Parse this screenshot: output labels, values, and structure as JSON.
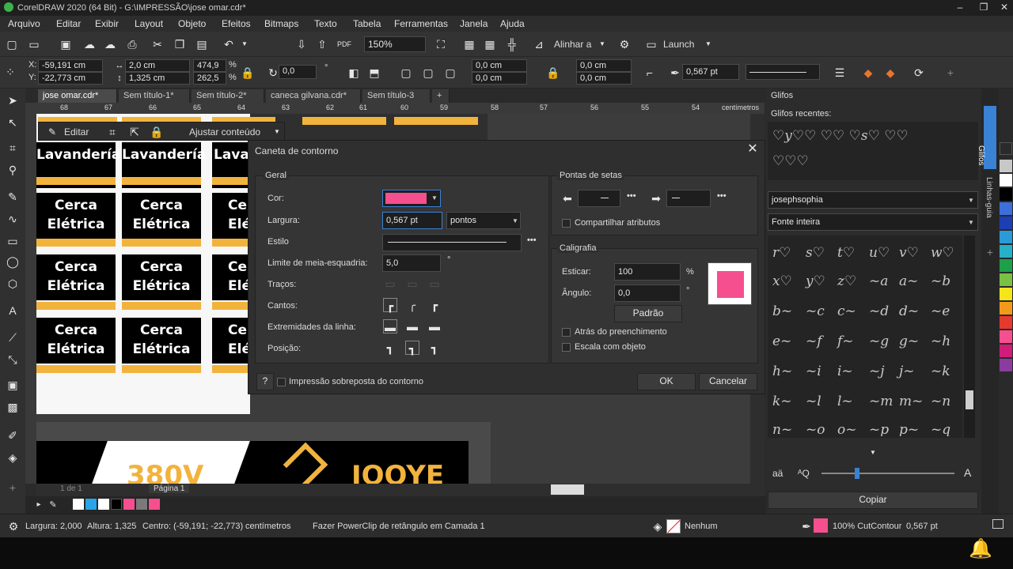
{
  "app": {
    "title": "CorelDRAW 2020 (64 Bit) - G:\\IMPRESSÃO\\jose omar.cdr*",
    "window_controls": [
      "–",
      "❐",
      "✕"
    ]
  },
  "menu": [
    "Arquivo",
    "Editar",
    "Exibir",
    "Layout",
    "Objeto",
    "Efeitos",
    "Bitmaps",
    "Texto",
    "Tabela",
    "Ferramentas",
    "Janela",
    "Ajuda"
  ],
  "toolbar": {
    "zoom": "150%",
    "align_label": "Alinhar a",
    "launch_label": "Launch"
  },
  "propbar": {
    "x": "-59,191 cm",
    "y": "-22,773 cm",
    "width": "2,0 cm",
    "height": "1,325 cm",
    "scale_w": "474,9",
    "scale_h": "262,5",
    "percent": "%",
    "rotation": "0,0",
    "degree": "°",
    "corner_tl": "0,0 cm",
    "corner_bl": "0,0 cm",
    "corner_tr": "0,0 cm",
    "corner_br": "0,0 cm",
    "outline_width": "0,567 pt"
  },
  "tabs": [
    "jose omar.cdr*",
    "Sem título-1*",
    "Sem título-2*",
    "caneca gilvana.cdr*",
    "Sem título-3",
    "+"
  ],
  "ruler": {
    "ticks": [
      "68",
      "67",
      "66",
      "65",
      "64",
      "63",
      "62",
      "61",
      "60",
      "59",
      "58",
      "57",
      "56",
      "55",
      "54"
    ],
    "unit": "centímetros"
  },
  "powerclip_bar": {
    "edit": "Editar",
    "adjust": "Ajustar conteúdo"
  },
  "canvas": {
    "row1": "Lavandería",
    "row_other_line1": "Cerca",
    "row_other_line2": "Elétrica",
    "cut_top": "Lava",
    "cut_c": "Ce",
    "cut_e": "Elé",
    "banner_text_1": "380V",
    "banner_text_2": "JOOYE"
  },
  "page_nav": {
    "page_count": "1 de 1",
    "page_label": "Página 1"
  },
  "dialog": {
    "title": "Caneta de contorno",
    "general": "Geral",
    "color_label": "Cor:",
    "width_label": "Largura:",
    "width_value": "0,567 pt",
    "width_unit": "pontos",
    "style_label": "Estilo",
    "miter_label": "Limite de meia-esquadria:",
    "miter_value": "5,0",
    "miter_unit": "°",
    "dashes_label": "Traços:",
    "corners_label": "Cantos:",
    "caps_label": "Extremidades da linha:",
    "position_label": "Posição:",
    "arrows_title": "Pontas de setas",
    "share_attrs": "Compartilhar atributos",
    "calligraphy_title": "Caligrafia",
    "stretch_label": "Esticar:",
    "stretch_value": "100",
    "stretch_unit": "%",
    "angle_label": "Ângulo:",
    "angle_value": "0,0",
    "angle_unit": "°",
    "default_button": "Padrão",
    "behind_fill": "Atrás do preenchimento",
    "scale_with_object": "Escala com objeto",
    "help_button": "?",
    "overprint": "Impressão sobreposta do contorno",
    "ok": "OK",
    "cancel": "Cancelar",
    "colors": {
      "pen": "#f64f8f"
    }
  },
  "glyphs_panel": {
    "title": "Glifos",
    "recent_label": "Glifos recentes:",
    "recent_row1": "♡y♡♡ ♡♡ ♡s♡ ♡♡",
    "recent_row2": "♡♡♡",
    "font": "josephsophia",
    "filter": "Fonte inteira",
    "grid": [
      [
        "r♡",
        "s♡",
        "t♡",
        "u♡",
        "v♡",
        "w♡"
      ],
      [
        "x♡",
        "y♡",
        "z♡",
        "~a",
        "a~",
        "~b"
      ],
      [
        "b~",
        "~c",
        "c~",
        "~d",
        "d~",
        "~e"
      ],
      [
        "e~",
        "~f",
        "f~",
        "~g",
        "g~",
        "~h"
      ],
      [
        "h~",
        "~i",
        "i~",
        "~j",
        "j~",
        "~k"
      ],
      [
        "k~",
        "~l",
        "l~",
        "~m",
        "m~",
        "~n"
      ],
      [
        "n~",
        "~o",
        "o~",
        "~p",
        "p~",
        "~q"
      ]
    ],
    "copy_button": "Copiar",
    "dock_tabs": [
      "Glifos",
      "Linhas-guia"
    ]
  },
  "status": {
    "width": "Largura: 2,000",
    "height": "Altura: 1,325",
    "center": "Centro: (-59,191; -22,773)",
    "units": "centímetros",
    "hint": "Fazer PowerClip de retângulo em Camada 1",
    "fill_state": "Nenhum",
    "outline": "100% CutContour",
    "outline_width": "0,567 pt"
  },
  "palette_colors": [
    "#c8c8c8",
    "#ffffff",
    "#000000",
    "#3c6fd8",
    "#1c3fb5",
    "#2a9bd8",
    "#26b0c9",
    "#1ea04a",
    "#7ac143",
    "#f6e51a",
    "#f39a1b",
    "#e63a2e",
    "#f64f8f",
    "#d21c7a",
    "#8b3ca0"
  ],
  "doc_palette": [
    "#ffffff",
    "#2aa4e8",
    "#ffffff",
    "#000000",
    "#2b2b2b",
    "#f64f8f",
    "#7a7a7a",
    "#f64f8f"
  ]
}
